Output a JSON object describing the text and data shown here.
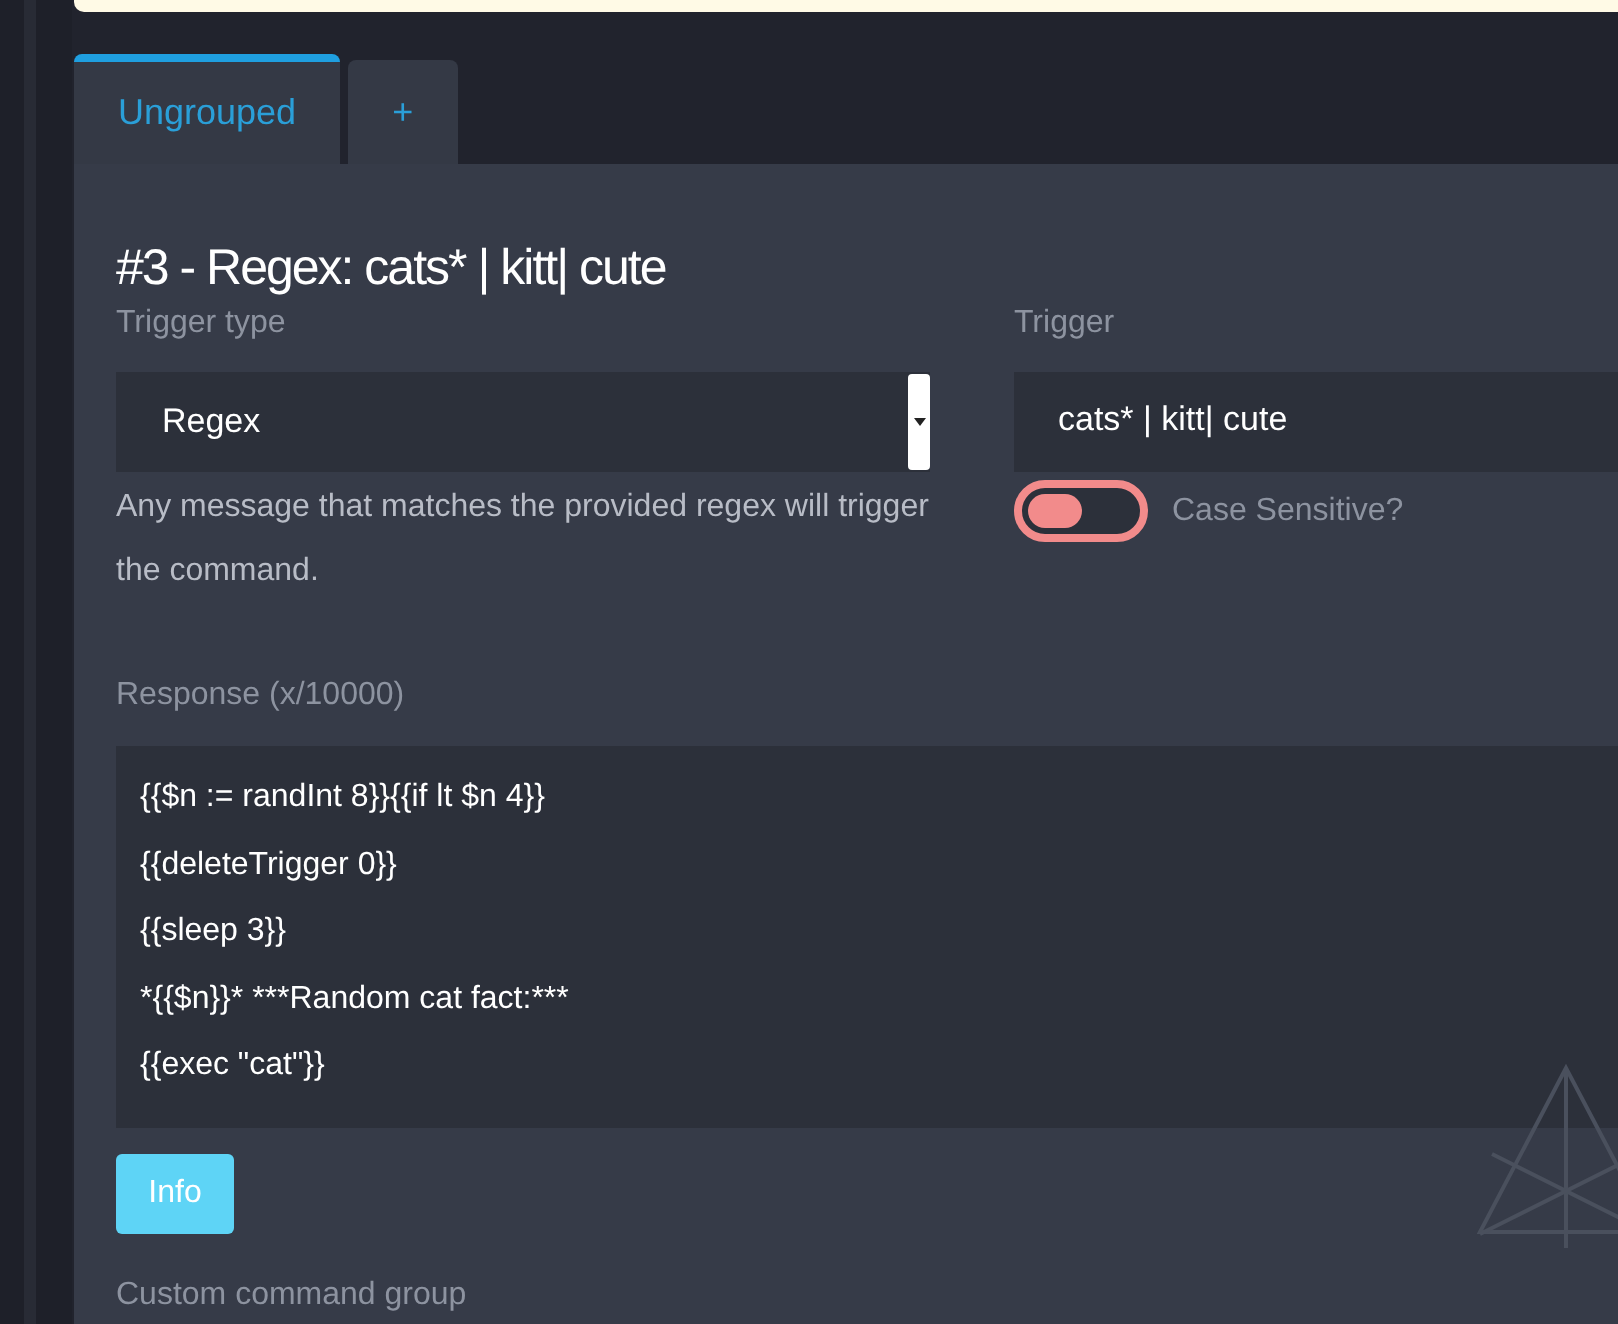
{
  "tabs": [
    {
      "label": "Ungrouped",
      "selected": true
    },
    {
      "label": "+",
      "selected": false
    }
  ],
  "command": {
    "title": "#3 - Regex: cats* | kitt| cute",
    "trigger_type": {
      "label": "Trigger type",
      "value": "Regex",
      "help": "Any message that matches the provided regex will trigger the command."
    },
    "trigger": {
      "label": "Trigger",
      "value": "cats* | kitt| cute",
      "case_sensitive": {
        "label": "Case Sensitive?",
        "on": false
      }
    },
    "response": {
      "label": "Response (x/10000)",
      "lines": [
        "{{$n := randInt 8}}{{if lt $n 4}}",
        "{{deleteTrigger 0}}",
        "{{sleep 3}}",
        "*{{$n}}* ***Random cat fact:***",
        "{{exec \"cat\"}}"
      ]
    },
    "info_button": "Info",
    "group_label": "Custom command group"
  }
}
